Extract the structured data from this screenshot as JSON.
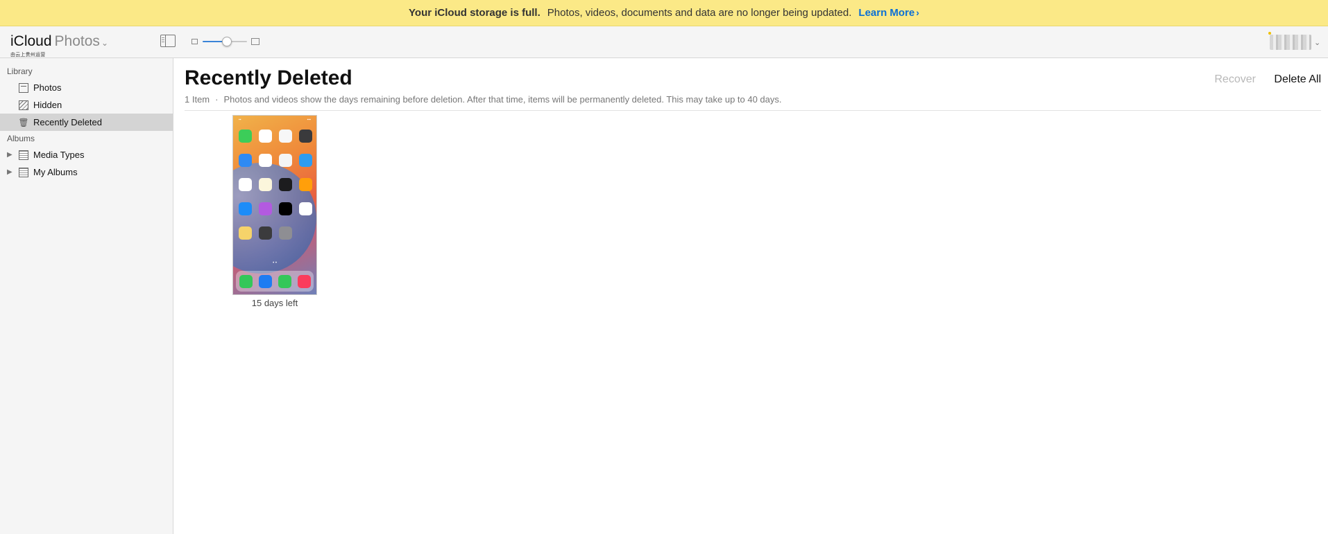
{
  "banner": {
    "bold": "Your iCloud storage is full.",
    "message": "Photos, videos, documents and data are no longer being updated.",
    "link": "Learn More",
    "link_chevron": "›"
  },
  "header": {
    "brand_primary": "iCloud",
    "brand_secondary": "Photos",
    "brand_chevron": "⌄",
    "brand_sub": "由云上贵州运营",
    "account_chevron": "⌄"
  },
  "sidebar": {
    "library_heading": "Library",
    "library_items": [
      {
        "label": "Photos",
        "icon": "photos-icon"
      },
      {
        "label": "Hidden",
        "icon": "hidden-icon"
      },
      {
        "label": "Recently Deleted",
        "icon": "trash-icon",
        "selected": true
      }
    ],
    "albums_heading": "Albums",
    "album_items": [
      {
        "label": "Media Types",
        "icon": "album-icon",
        "expand_icon": "▶"
      },
      {
        "label": "My Albums",
        "icon": "album-icon",
        "expand_icon": "▶"
      }
    ]
  },
  "main": {
    "title": "Recently Deleted",
    "count": "1 Item",
    "separator": "·",
    "description": "Photos and videos show the days remaining before deletion. After that time, items will be permanently deleted. This may take up to 40 days.",
    "recover_label": "Recover",
    "delete_all_label": "Delete All",
    "items": [
      {
        "caption": "15 days left",
        "type": "screenshot"
      }
    ]
  },
  "zoom": {
    "level": 0.55
  },
  "colors": {
    "banner_bg": "#fbe987",
    "link": "#0a6fd6",
    "slider_fill": "#3a84d8",
    "selected_row": "#d4d4d4"
  }
}
